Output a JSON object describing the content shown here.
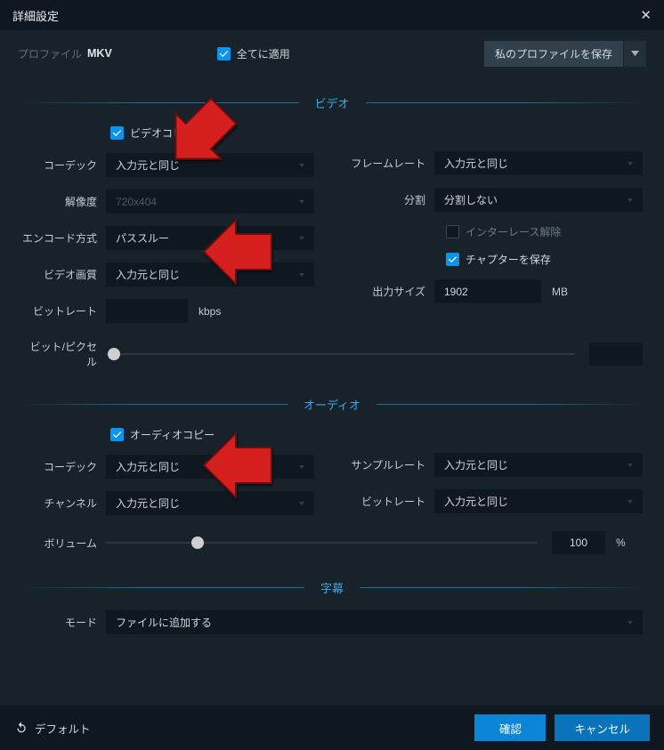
{
  "title": "詳細設定",
  "profile": {
    "label": "プロファイル",
    "name": "MKV"
  },
  "apply_all": {
    "label": "全てに適用",
    "checked": true
  },
  "save_profile": {
    "label": "私のプロファイルを保存"
  },
  "sections": {
    "video": "ビデオ",
    "audio": "オーディオ",
    "subtitle": "字幕"
  },
  "video": {
    "video_copy": {
      "label": "ビデオコピー",
      "checked": true
    },
    "codec": {
      "label": "コーデック",
      "value": "入力元と同じ"
    },
    "resolution": {
      "label": "解像度",
      "placeholder": "720x404"
    },
    "encode": {
      "label": "エンコード方式",
      "value": "パススルー"
    },
    "quality": {
      "label": "ビデオ画質",
      "value": "入力元と同じ"
    },
    "bitrate": {
      "label": "ビットレート",
      "value": "",
      "unit": "kbps"
    },
    "framerate": {
      "label": "フレームレート",
      "value": "入力元と同じ"
    },
    "split": {
      "label": "分割",
      "value": "分割しない"
    },
    "deinterlace": {
      "label": "インターレース解除",
      "checked": false
    },
    "save_chapters": {
      "label": "チャプターを保存",
      "checked": true
    },
    "output_size": {
      "label": "出力サイズ",
      "value": "1902",
      "unit": "MB"
    },
    "bit_per_pixel": {
      "label": "ビット/ピクセル",
      "out": ""
    }
  },
  "audio": {
    "audio_copy": {
      "label": "オーディオコピー",
      "checked": true
    },
    "codec": {
      "label": "コーデック",
      "value": "入力元と同じ"
    },
    "channel": {
      "label": "チャンネル",
      "value": "入力元と同じ"
    },
    "samplerate": {
      "label": "サンプルレート",
      "value": "入力元と同じ"
    },
    "bitrate": {
      "label": "ビットレート",
      "value": "入力元と同じ"
    },
    "volume": {
      "label": "ボリューム",
      "value": "100",
      "unit": "%"
    }
  },
  "subtitle": {
    "mode": {
      "label": "モード",
      "value": "ファイルに追加する"
    }
  },
  "footer": {
    "default": "デフォルト",
    "ok": "確認",
    "cancel": "キャンセル"
  }
}
